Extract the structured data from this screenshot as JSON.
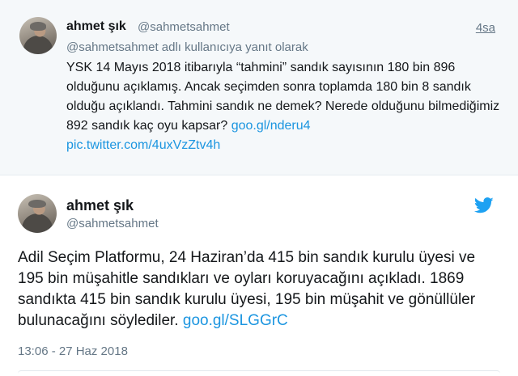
{
  "parent_tweet": {
    "name": "ahmet şık",
    "handle": "@sahmetsahmet",
    "time": "4sa",
    "reply_context": "@sahmetsahmet adlı kullanıcıya yanıt olarak",
    "text": "YSK 14 Mayıs 2018 itibarıyla “tahmini” sandık sayısının 180 bin 896 olduğunu açıklamış. Ancak seçimden sonra toplamda 180 bin 8 sandık olduğu açıklandı. Tahmini sandık ne demek? Nerede olduğunu bilmediğimiz 892 sandık kaç oyu kapsar? ",
    "link": "goo.gl/nderu4",
    "pic_link": "pic.twitter.com/4uxVzZtv4h"
  },
  "main_tweet": {
    "name": "ahmet şık",
    "handle": "@sahmetsahmet",
    "text": "Adil Seçim Platformu, 24 Haziran’da 415 bin sandık kurulu üyesi ve 195 bin müşahitle sandıkları ve oyları koruyacağını açıkladı. 1869 sandıkta 415 bin sandık kurulu üyesi, 195 bin müşahit ve gönüllüler bulunacağını söylediler. ",
    "link": "goo.gl/SLGGrC",
    "timestamp": "13:06 - 27 Haz 2018"
  },
  "icons": {
    "brand": "twitter-bird-icon",
    "brand_color": "#1da1f2",
    "link_color": "#1b95e0"
  }
}
